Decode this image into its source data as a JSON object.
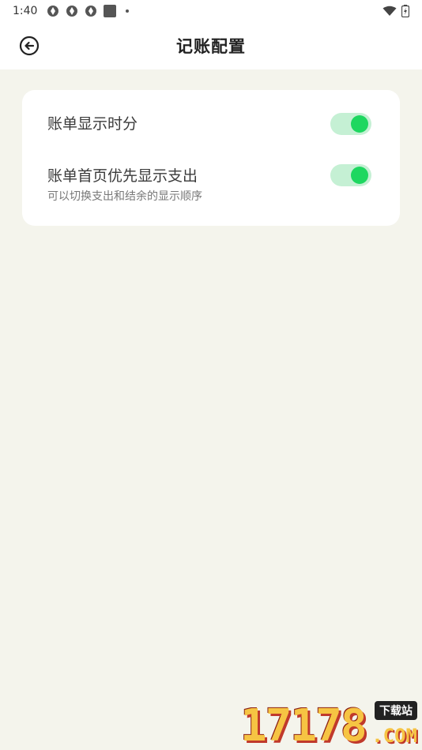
{
  "status_bar": {
    "time": "1:40",
    "icons": [
      "app-notification-icon",
      "app-notification-icon",
      "app-notification-icon",
      "stop-icon",
      "dot-icon"
    ],
    "right_icons": [
      "wifi-icon",
      "battery-charging-icon"
    ]
  },
  "header": {
    "title": "记账配置",
    "back_icon": "back-arrow-circle-icon"
  },
  "settings": {
    "items": [
      {
        "label": "账单显示时分",
        "sublabel": "",
        "enabled": true
      },
      {
        "label": "账单首页优先显示支出",
        "sublabel": "可以切换支出和结余的显示顺序",
        "enabled": true
      }
    ]
  },
  "colors": {
    "background": "#f4f4ec",
    "card": "#ffffff",
    "toggle_track_on": "#c5f0d4",
    "toggle_knob_on": "#1ed760"
  },
  "watermark": {
    "digits": "17178",
    "domain": ".COM",
    "badge": "下载站"
  }
}
